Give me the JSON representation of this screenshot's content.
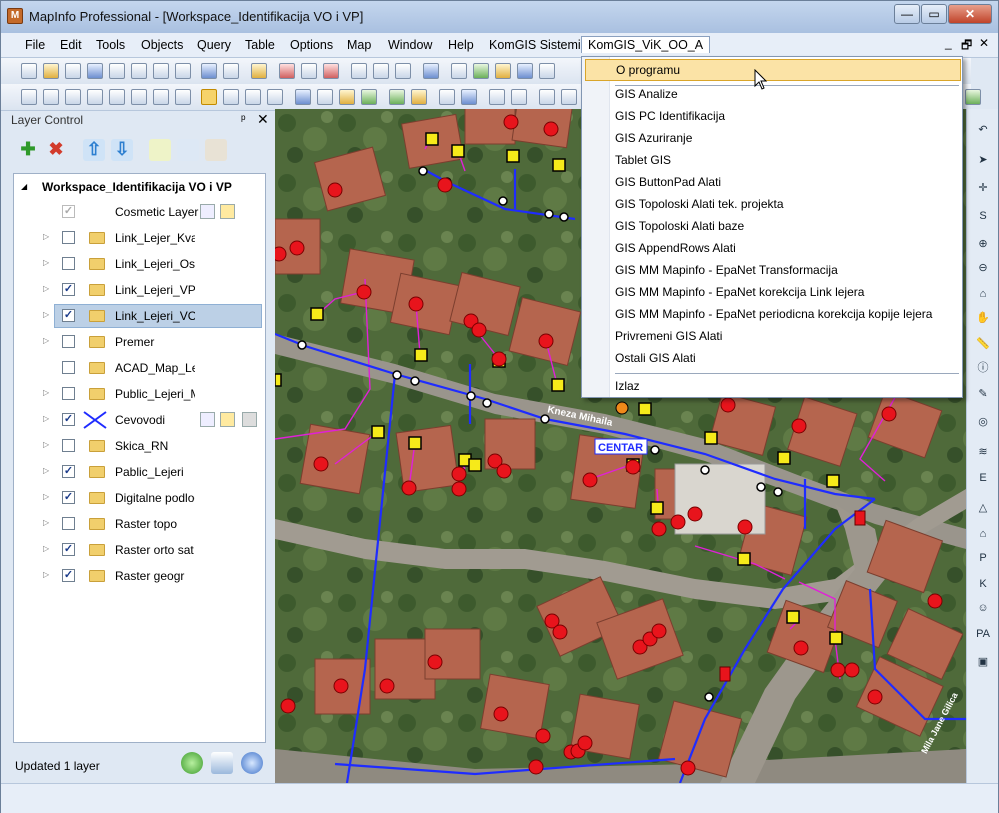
{
  "window": {
    "app_icon": "mapinfo-icon",
    "title": "MapInfo Professional - [Workspace_Identifikacija VO i VP]",
    "minimize": "—",
    "maximize": "▭",
    "close": "✕"
  },
  "menubar": {
    "items": [
      "File",
      "Edit",
      "Tools",
      "Objects",
      "Query",
      "Table",
      "Options",
      "Map",
      "Window",
      "Help",
      "KomGIS Sistemi",
      "KomGIS_ViK_OO_A"
    ],
    "mdi_controls": [
      "_",
      "🗗",
      "✕"
    ]
  },
  "dropdown": {
    "items": [
      "O programu",
      "GIS Analize",
      "GIS PC Identifikacija",
      "GIS Azuriranje",
      "Tablet GIS",
      "GIS ButtonPad Alati",
      "GIS Topoloski Alati tek. projekta",
      "GIS Topoloski Alati baze",
      "GIS AppendRows Alati",
      "GIS MM Mapinfo - EpaNet Transformacija",
      "GIS MM Mapinfo - EpaNet korekcija Link lejera",
      "GIS MM Mapinfo - EpaNet periodicna korekcija kopije lejera",
      "Privremeni GIS Alati",
      "Ostali GIS Alati"
    ],
    "exit": "Izlaz"
  },
  "layer_control": {
    "title": "Layer Control",
    "pin": "ᵖ",
    "close": "✕",
    "workspace": "Workspace_Identifikacija VO i VP",
    "layers": [
      {
        "name": "Cosmetic Layer",
        "checked": true
      },
      {
        "name": "Link_Lejer_Kvar",
        "checked": false
      },
      {
        "name": "Link_Lejeri_Ostali",
        "checked": false
      },
      {
        "name": "Link_Lejeri_VP",
        "checked": true
      },
      {
        "name": "Link_Lejeri_VO",
        "checked": true
      },
      {
        "name": "Premer",
        "checked": false
      },
      {
        "name": "ACAD_Map_Lejeri",
        "checked": false
      },
      {
        "name": "Public_Lejeri_M",
        "checked": false
      },
      {
        "name": "Cevovodi",
        "checked": true
      },
      {
        "name": "Skica_RN",
        "checked": false
      },
      {
        "name": "Pablic_Lejeri",
        "checked": true
      },
      {
        "name": "Digitalne podloge",
        "checked": true
      },
      {
        "name": "Raster topo",
        "checked": false
      },
      {
        "name": "Raster orto sat",
        "checked": true
      },
      {
        "name": "Raster geogr",
        "checked": true
      }
    ],
    "status": "Updated 1 layer"
  },
  "map_labels": {
    "street1": "Kneza Mihaila",
    "place": "CENTAR",
    "street2": "Mila Jane Gilica"
  },
  "right_toolbar": [
    "↶",
    "➤",
    "✛",
    "S",
    "⊕",
    "⊖",
    "⌂",
    "✋",
    "📏",
    "ⓘ",
    "✎",
    "◎",
    "≋",
    "E",
    "△",
    "⌂",
    "P",
    "K",
    "☺",
    "PA",
    "▣"
  ],
  "colors": {
    "menu_hover": "#fbe3a6",
    "selected_layer": "#bcd0e6",
    "point_red": "#e8141c",
    "pipe_blue": "#1f2cff",
    "link_magenta": "#e020d8"
  }
}
